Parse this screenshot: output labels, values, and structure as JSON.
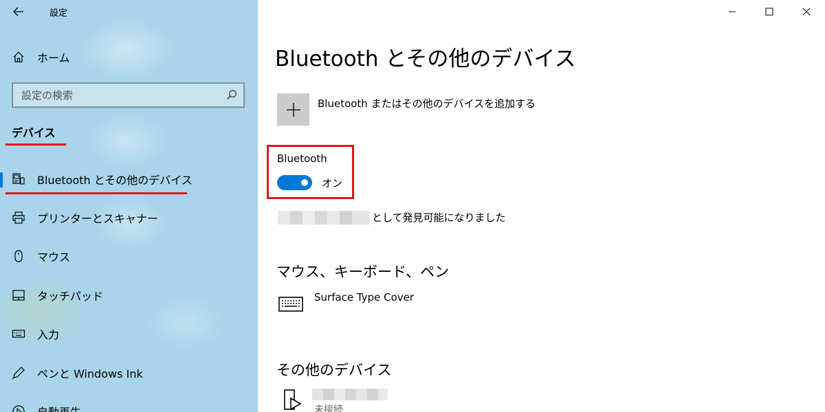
{
  "window": {
    "app_title": "設定",
    "controls": {
      "minimize_icon": "minimize-icon",
      "maximize_icon": "maximize-icon",
      "close_icon": "close-icon"
    }
  },
  "sidebar": {
    "home_label": "ホーム",
    "search": {
      "placeholder": "設定の検索"
    },
    "section_title": "デバイス",
    "items": [
      {
        "label": "Bluetooth とその他のデバイス",
        "icon": "bluetooth-devices-icon",
        "active": true
      },
      {
        "label": "プリンターとスキャナー",
        "icon": "printer-icon"
      },
      {
        "label": "マウス",
        "icon": "mouse-icon"
      },
      {
        "label": "タッチパッド",
        "icon": "touchpad-icon"
      },
      {
        "label": "入力",
        "icon": "keyboard-icon"
      },
      {
        "label": "ペンと Windows Ink",
        "icon": "pen-icon"
      },
      {
        "label": "自動再生",
        "icon": "autoplay-icon"
      }
    ]
  },
  "main": {
    "title": "Bluetooth とその他のデバイス",
    "add_device_label": "Bluetooth またはその他のデバイスを追加する",
    "bluetooth": {
      "label": "Bluetooth",
      "toggle_state": "オン",
      "enabled": true
    },
    "discoverable_text": "として発見可能になりました",
    "mouse_section": {
      "title": "マウス、キーボード、ペン",
      "devices": [
        {
          "name": "Surface Type Cover",
          "icon": "keyboard-icon"
        }
      ]
    },
    "other_section": {
      "title": "その他のデバイス",
      "devices": [
        {
          "status": "未接続",
          "icon": "media-device-icon"
        }
      ]
    }
  },
  "colors": {
    "sidebar_bg": "#a9d4ea",
    "accent": "#0078d7",
    "annotation_red": "#e0161b",
    "add_button_bg": "#cccccc"
  }
}
